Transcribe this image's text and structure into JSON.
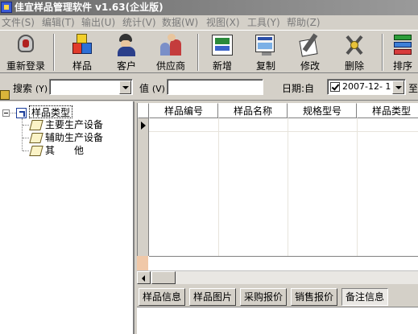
{
  "window": {
    "title": "佳宜样品管理软件 v1.63(企业版)"
  },
  "menu": [
    "文件(S)",
    "编辑(T)",
    "输出(U)",
    "统计(V)",
    "数据(W)",
    "视图(X)",
    "工具(Y)",
    "帮助(Z)"
  ],
  "toolbar": {
    "relogin": "重新登录",
    "sample": "样品",
    "client": "客户",
    "supplier": "供应商",
    "new": "新增",
    "copy": "复制",
    "edit": "修改",
    "delete": "删除",
    "sort": "排序"
  },
  "search": {
    "search_label": "搜索",
    "search_value": "",
    "value_label": "值",
    "value_input": "",
    "date_label": "日期:自",
    "date_from": "2007-12- 1",
    "date_to_label": "至"
  },
  "tree": {
    "root": "样品类型",
    "children": [
      "主要生产设备",
      "辅助生产设备",
      "其　　他"
    ]
  },
  "grid": {
    "columns": [
      "样品编号",
      "样品名称",
      "规格型号",
      "样品类型"
    ]
  },
  "tabs": [
    "样品信息",
    "样品图片",
    "采购报价",
    "销售报价",
    "备注信息"
  ]
}
